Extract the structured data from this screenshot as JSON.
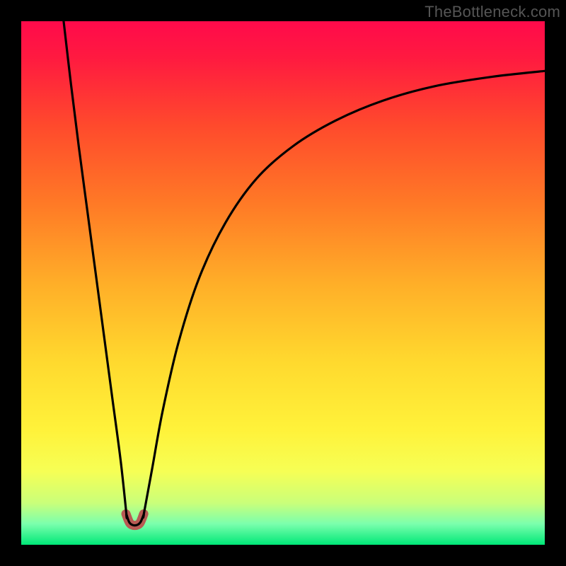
{
  "watermark": "TheBottleneck.com",
  "chart_data": {
    "type": "line",
    "title": "",
    "xlabel": "",
    "ylabel": "",
    "xlim": [
      0,
      1
    ],
    "ylim": [
      0,
      1
    ],
    "notch_center_x": 0.217,
    "notch_half_width": 0.017,
    "notch_floor_y": 0.037,
    "gradient_stops": [
      {
        "offset": 0.0,
        "color": "#ff0a4b"
      },
      {
        "offset": 0.07,
        "color": "#ff1a40"
      },
      {
        "offset": 0.2,
        "color": "#ff4a2c"
      },
      {
        "offset": 0.35,
        "color": "#ff7a26"
      },
      {
        "offset": 0.5,
        "color": "#ffae28"
      },
      {
        "offset": 0.65,
        "color": "#ffd92e"
      },
      {
        "offset": 0.78,
        "color": "#fff23a"
      },
      {
        "offset": 0.86,
        "color": "#f6ff55"
      },
      {
        "offset": 0.92,
        "color": "#caff7a"
      },
      {
        "offset": 0.96,
        "color": "#7bffad"
      },
      {
        "offset": 1.0,
        "color": "#00e878"
      }
    ],
    "series": [
      {
        "name": "left-branch",
        "x": [
          0.081,
          0.095,
          0.11,
          0.126,
          0.142,
          0.158,
          0.174,
          0.19,
          0.201
        ],
        "y": [
          1.0,
          0.88,
          0.76,
          0.64,
          0.52,
          0.4,
          0.28,
          0.16,
          0.058
        ]
      },
      {
        "name": "notch",
        "x": [
          0.201,
          0.207,
          0.217,
          0.227,
          0.234
        ],
        "y": [
          0.058,
          0.042,
          0.037,
          0.042,
          0.058
        ]
      },
      {
        "name": "right-branch",
        "x": [
          0.234,
          0.25,
          0.27,
          0.3,
          0.34,
          0.39,
          0.45,
          0.52,
          0.6,
          0.69,
          0.79,
          0.9,
          1.0
        ],
        "y": [
          0.058,
          0.145,
          0.255,
          0.385,
          0.51,
          0.615,
          0.7,
          0.762,
          0.81,
          0.848,
          0.876,
          0.894,
          0.905
        ]
      }
    ],
    "notch_highlight_color": "#b85a54",
    "curve_color": "#000000"
  }
}
